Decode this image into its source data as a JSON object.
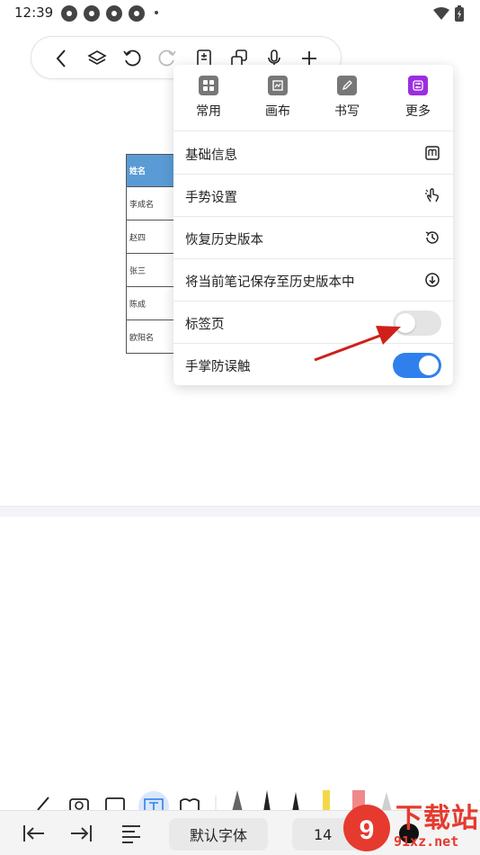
{
  "status_bar": {
    "time": "12:39"
  },
  "table": {
    "header": "姓名",
    "rows": [
      "李成名",
      "赵四",
      "张三",
      "陈成",
      "欧阳名"
    ]
  },
  "menu": {
    "tabs": [
      {
        "label": "常用",
        "icon": "grid-icon",
        "color": "#777777"
      },
      {
        "label": "画布",
        "icon": "canvas-icon",
        "color": "#777777"
      },
      {
        "label": "书写",
        "icon": "pen-icon",
        "color": "#777777"
      },
      {
        "label": "更多",
        "icon": "more-settings-icon",
        "color": "#9b2ee0"
      }
    ],
    "items": [
      {
        "label": "基础信息",
        "icon": "info-book-icon"
      },
      {
        "label": "手势设置",
        "icon": "gesture-hand-icon"
      },
      {
        "label": "恢复历史版本",
        "icon": "history-icon"
      },
      {
        "label": "将当前笔记保存至历史版本中",
        "icon": "download-circle-icon"
      },
      {
        "label": "标签页",
        "toggle": false
      },
      {
        "label": "手掌防误触",
        "toggle": true
      }
    ],
    "toggle_on_color": "#2f80ed",
    "toggle_off_color": "#e4e4e4"
  },
  "bottom_bar": {
    "font_name": "默认字体",
    "font_size": "14"
  },
  "watermark": {
    "title": "下载站",
    "domain": "91xz.net"
  }
}
